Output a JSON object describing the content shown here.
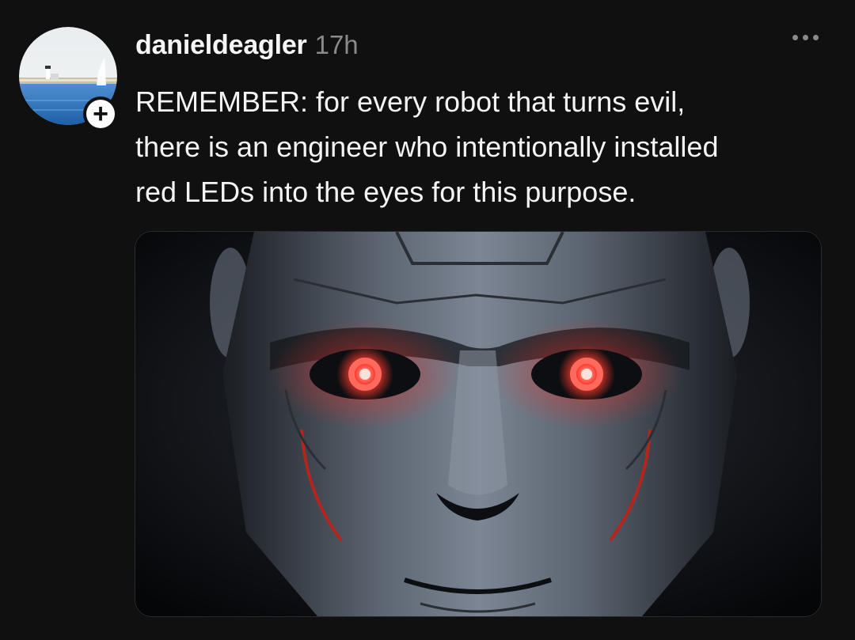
{
  "post": {
    "username": "danieldeagler",
    "time": "17h",
    "text": "REMEMBER: for every robot that turns evil,\nthere is an engineer who intentionally installed\nred LEDs into the eyes for this purpose.",
    "follow_symbol": "+",
    "more_icon": "more-horizontal-icon",
    "avatar_icon": "lighthouse-seascape-avatar",
    "media_icon": "robot-face-red-eyes-image"
  },
  "colors": {
    "background": "#101010",
    "text": "#f3f3f3",
    "muted": "#8a8a8a",
    "led_red": "#ff3b2f"
  }
}
